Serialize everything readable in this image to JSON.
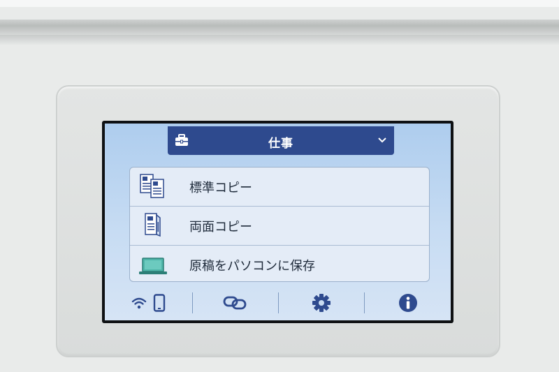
{
  "device": {
    "screen": {
      "header": {
        "title": "仕事",
        "icon": "briefcase-icon",
        "dropdown_icon": "chevron-down-icon"
      },
      "menu": {
        "items": [
          {
            "label": "標準コピー",
            "icon": "standard-copy-icon"
          },
          {
            "label": "両面コピー",
            "icon": "duplex-copy-icon"
          },
          {
            "label": "原稿をパソコンに保存",
            "icon": "laptop-icon"
          }
        ]
      },
      "toolbar": {
        "items": [
          {
            "name": "wireless-status",
            "icons": [
              "wifi-icon",
              "smartphone-icon"
            ]
          },
          {
            "name": "connect",
            "icon": "link-icon"
          },
          {
            "name": "settings",
            "icon": "gear-icon"
          },
          {
            "name": "info",
            "icon": "info-icon"
          }
        ]
      }
    },
    "colors": {
      "header_bg": "#2e4a8e",
      "screen_bg": "#c7dcf3",
      "menu_bg": "#e4ecf7",
      "icon_blue": "#2e4a8e",
      "laptop_teal": "#4fb5a9"
    }
  }
}
